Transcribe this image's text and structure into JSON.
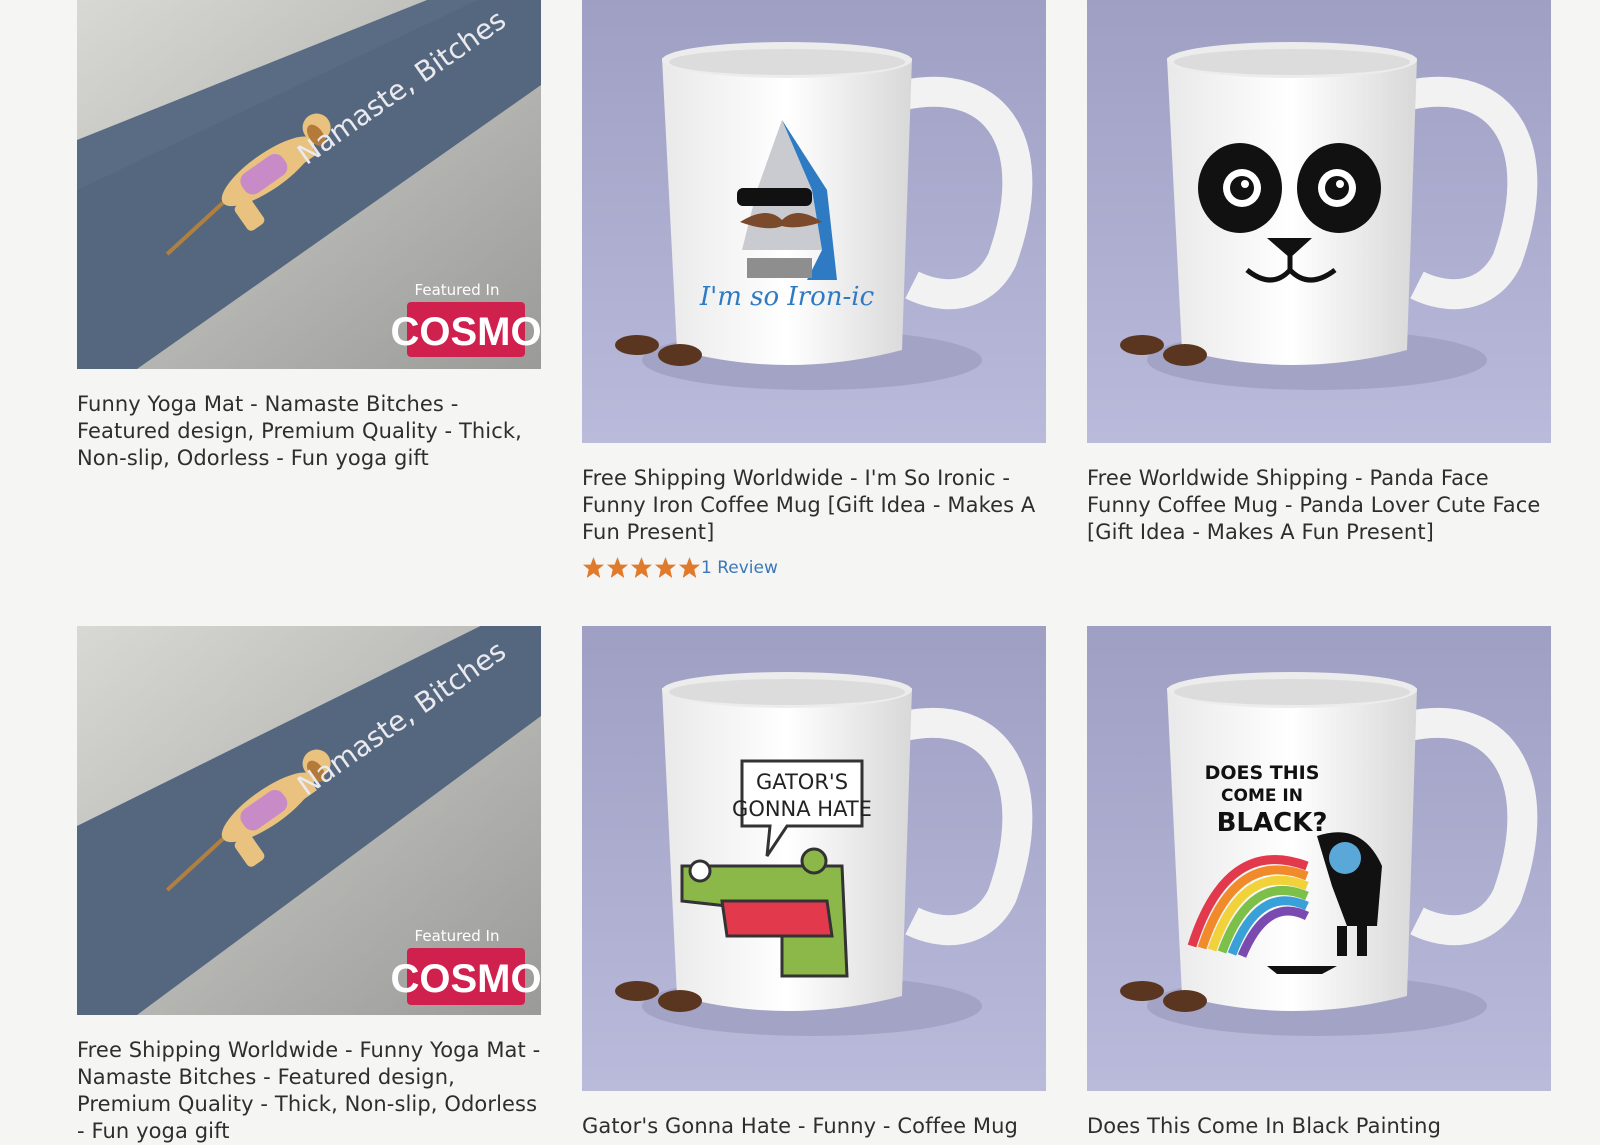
{
  "products_row1": [
    {
      "title": "Funny Yoga Mat - Namaste Bitches - Featured design, Premium Quality - Thick, Non-slip, Odorless - Fun yoga gift",
      "image": {
        "mat_text": "Namaste, Bitches",
        "badge_top": "Featured In",
        "badge_brand": "COSMO"
      }
    },
    {
      "title": "Free Shipping Worldwide - I'm So Ironic - Funny Iron Coffee Mug [Gift Idea - Makes A Fun Present]",
      "image": {
        "mug_text": "I'm so Iron-ic"
      },
      "rating": {
        "stars": 5,
        "review_text": "1 Review"
      }
    },
    {
      "title": "Free Worldwide Shipping - Panda Face Funny Coffee Mug - Panda Lover Cute Face [Gift Idea - Makes A Fun Present]",
      "image": {
        "mug_text": ""
      }
    }
  ],
  "products_row2": [
    {
      "title": "Free Shipping Worldwide - Funny Yoga Mat - Namaste Bitches - Featured design, Premium Quality - Thick, Non-slip, Odorless - Fun yoga gift",
      "image": {
        "mat_text": "Namaste, Bitches",
        "badge_top": "Featured In",
        "badge_brand": "COSMO"
      }
    },
    {
      "title": "Gator's Gonna Hate - Funny - Coffee Mug",
      "image": {
        "bubble_line1": "GATOR'S",
        "bubble_line2": "GONNA HATE"
      }
    },
    {
      "title": "Does This Come In Black Painting",
      "image": {
        "line1": "DOES THIS",
        "line2": "COME IN",
        "line3": "BLACK?"
      }
    }
  ],
  "colors": {
    "star": "#e07b2e",
    "link": "#3b78b8",
    "mug_bg": "#a9a9cf",
    "mat": "#55677f"
  }
}
